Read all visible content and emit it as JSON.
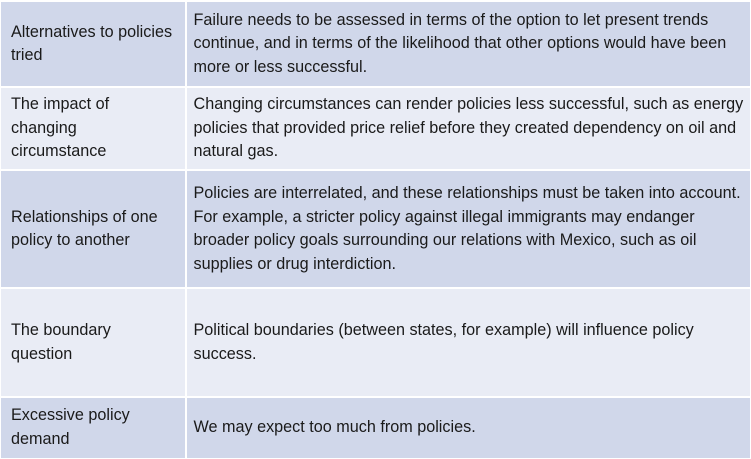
{
  "rows": [
    {
      "label": "Alternatives to policies tried",
      "text": "Failure needs to be assessed in terms of the option to let present trends continue, and in terms of the likelihood that other options would have been more or less successful."
    },
    {
      "label": "The impact of changing circumstance",
      "text": "Changing circumstances can render policies less successful, such as energy policies that provided price relief before they created dependency on oil and natural gas."
    },
    {
      "label": "Relationships of one policy to another",
      "text": "Policies are interrelated, and these relationships must be taken into account. For example, a stricter policy against illegal immigrants may endanger broader policy goals surrounding our relations with Mexico, such as oil supplies or drug interdiction."
    },
    {
      "label": "The boundary question",
      "text": "Political boundaries (between states, for example) will influence policy success."
    },
    {
      "label": "Excessive policy demand",
      "text": "We may expect too much from policies."
    }
  ]
}
